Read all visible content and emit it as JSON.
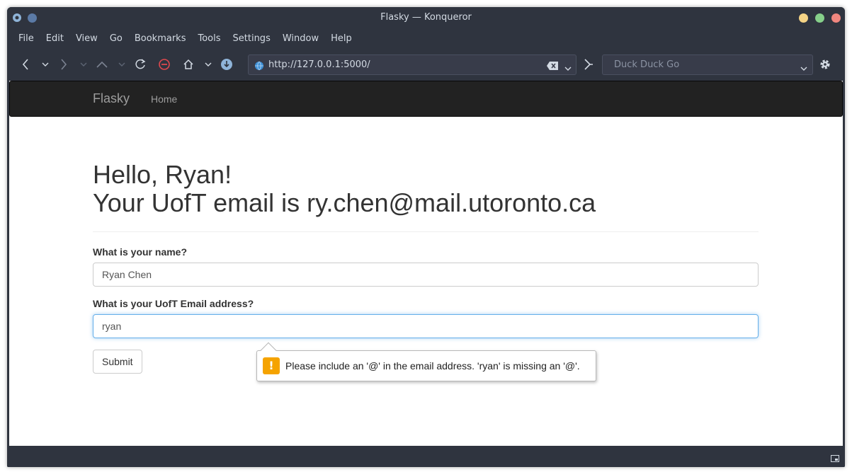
{
  "window": {
    "title": "Flasky — Konqueror"
  },
  "menu": [
    "File",
    "Edit",
    "View",
    "Go",
    "Bookmarks",
    "Tools",
    "Settings",
    "Window",
    "Help"
  ],
  "toolbar": {
    "url": "http://127.0.0.1:5000/",
    "search_placeholder": "Duck Duck Go"
  },
  "navbar": {
    "brand": "Flasky",
    "home": "Home"
  },
  "page": {
    "greeting": "Hello, Ryan!",
    "email_line": "Your UofT email is ry.chen@mail.utoronto.ca",
    "name_label": "What is your name?",
    "name_value": "Ryan Chen",
    "email_label": "What is your UofT Email address?",
    "email_value": "ryan",
    "submit_label": "Submit"
  },
  "validation": {
    "message": "Please include an '@' in the email address. 'ryan' is missing an '@'.",
    "icon": "!"
  },
  "colors": {
    "window_bg": "#2f343f",
    "navbar_bg": "#222222",
    "warning": "#f5a300",
    "focus": "#66afe9"
  }
}
